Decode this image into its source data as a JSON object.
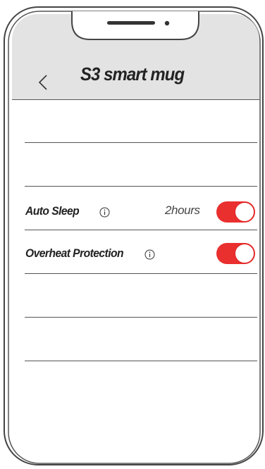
{
  "header": {
    "title": "S3 smart mug",
    "back_icon": "chevron-left-icon"
  },
  "settings": [
    {
      "label": "Auto Sleep",
      "info_icon": "info-icon",
      "value": "2hours",
      "enabled": true
    },
    {
      "label": "Overheat Protection",
      "info_icon": "info-icon",
      "value": "",
      "enabled": true
    }
  ],
  "colors": {
    "accent": "#ea2f2f",
    "header_bg": "#e3e3e3",
    "frame": "#444444"
  }
}
